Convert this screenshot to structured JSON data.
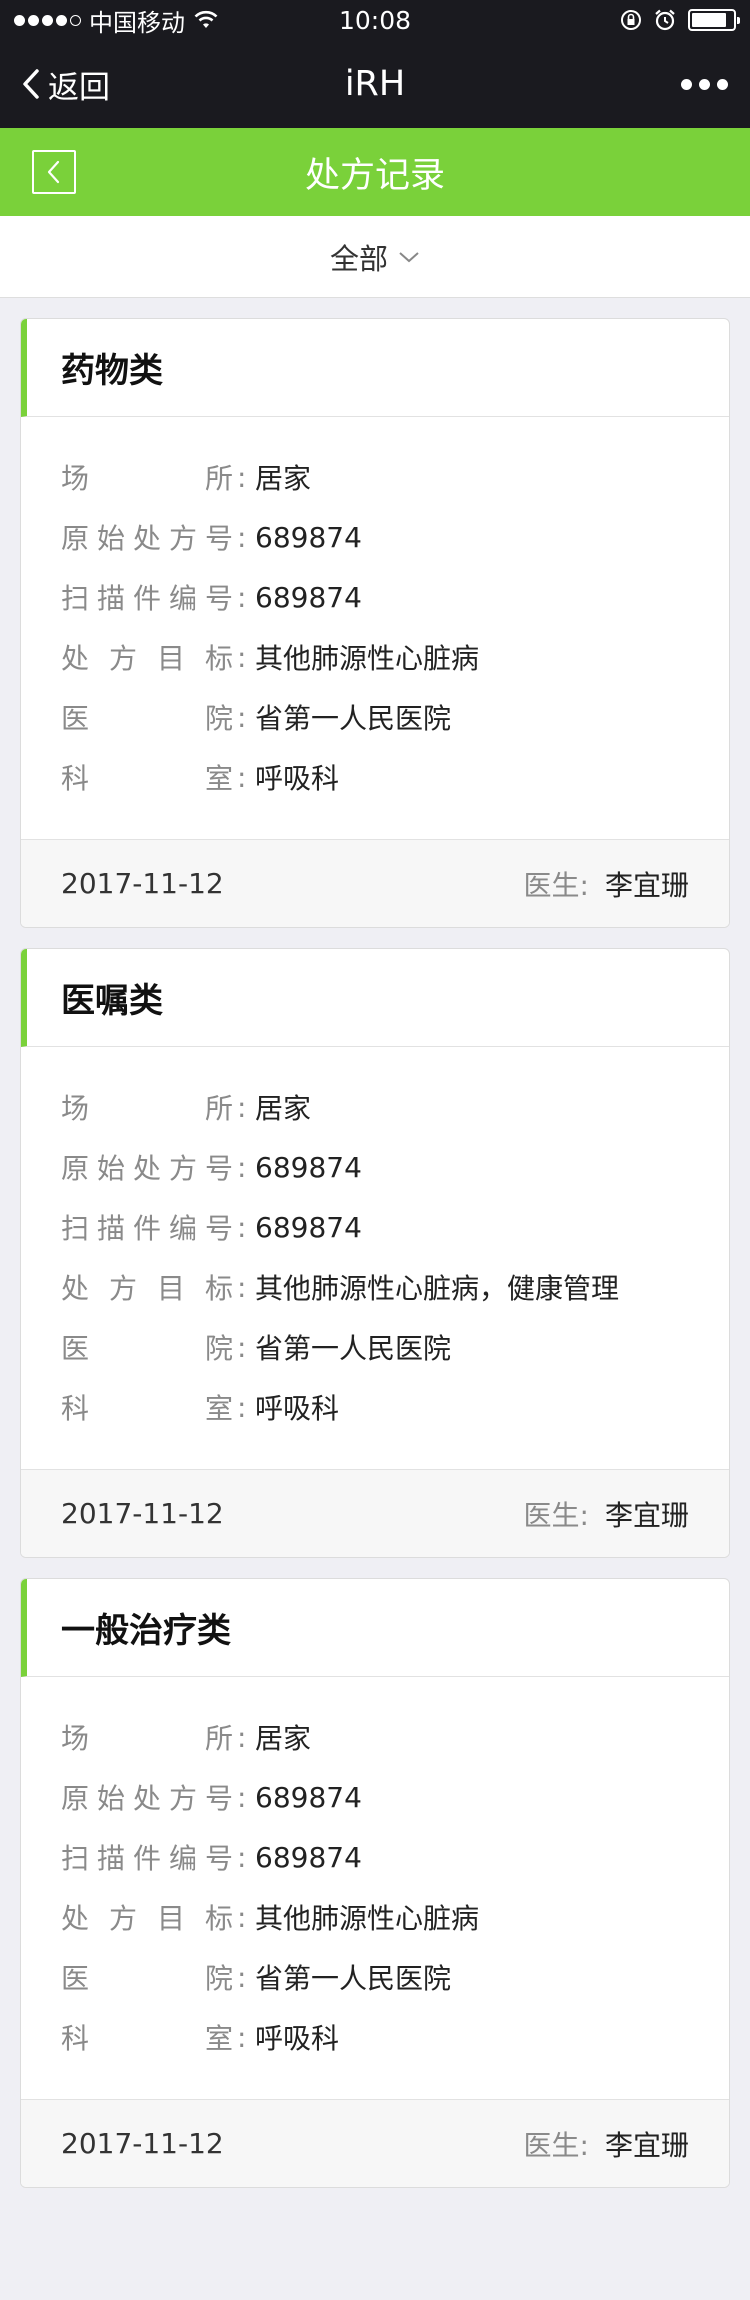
{
  "status_bar": {
    "carrier": "中国移动",
    "time": "10:08",
    "signal_bars_filled": 4,
    "signal_bars_total": 5,
    "battery_level": 0.85
  },
  "nav_bar": {
    "back_label": "返回",
    "title": "iRH"
  },
  "page_header": {
    "title": "处方记录"
  },
  "filter": {
    "selected": "全部"
  },
  "colors": {
    "accent_green": "#7ad13a",
    "nav_dark": "#1a1a1f",
    "background": "#efeff4"
  },
  "cards": [
    {
      "title": "药物类",
      "fields": [
        {
          "label": "场所",
          "value": "居家"
        },
        {
          "label": "原始处方号",
          "value": "689874"
        },
        {
          "label": "扫描件编号",
          "value": "689874"
        },
        {
          "label": "处方目标",
          "value": "其他肺源性心脏病"
        },
        {
          "label": "医院",
          "value": "省第一人民医院"
        },
        {
          "label": "科室",
          "value": "呼吸科"
        }
      ],
      "date": "2017-11-12",
      "doctor_label": "医生:",
      "doctor": "李宜珊"
    },
    {
      "title": "医嘱类",
      "fields": [
        {
          "label": "场所",
          "value": "居家"
        },
        {
          "label": "原始处方号",
          "value": "689874"
        },
        {
          "label": "扫描件编号",
          "value": "689874"
        },
        {
          "label": "处方目标",
          "value": "其他肺源性心脏病，健康管理"
        },
        {
          "label": "医院",
          "value": "省第一人民医院"
        },
        {
          "label": "科室",
          "value": "呼吸科"
        }
      ],
      "date": "2017-11-12",
      "doctor_label": "医生:",
      "doctor": "李宜珊"
    },
    {
      "title": "一般治疗类",
      "fields": [
        {
          "label": "场所",
          "value": "居家"
        },
        {
          "label": "原始处方号",
          "value": "689874"
        },
        {
          "label": "扫描件编号",
          "value": "689874"
        },
        {
          "label": "处方目标",
          "value": "其他肺源性心脏病"
        },
        {
          "label": "医院",
          "value": "省第一人民医院"
        },
        {
          "label": "科室",
          "value": "呼吸科"
        }
      ],
      "date": "2017-11-12",
      "doctor_label": "医生:",
      "doctor": "李宜珊"
    }
  ]
}
